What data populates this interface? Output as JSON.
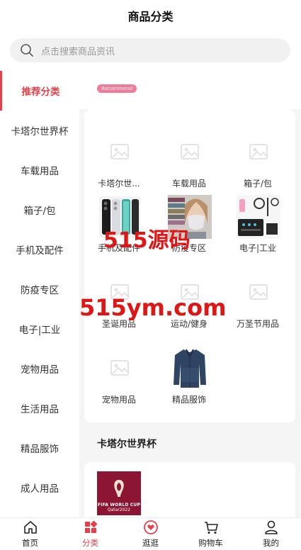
{
  "header": {
    "title": "商品分类"
  },
  "search": {
    "placeholder": "点击搜索商品资讯"
  },
  "sidebar": {
    "items": [
      {
        "label": "推荐分类",
        "active": true
      },
      {
        "label": "卡塔尔世界杯"
      },
      {
        "label": "车载用品"
      },
      {
        "label": "箱子/包"
      },
      {
        "label": "手机及配件"
      },
      {
        "label": "防疫专区"
      },
      {
        "label": "电子|工业"
      },
      {
        "label": "宠物用品"
      },
      {
        "label": "生活用品"
      },
      {
        "label": "精品服饰"
      },
      {
        "label": "成人用品"
      }
    ]
  },
  "recommend": {
    "badge": "Recommend"
  },
  "grid": {
    "items": [
      {
        "label": "卡塔尔世...",
        "icon": "image-placeholder-icon"
      },
      {
        "label": "车载用品",
        "icon": "image-placeholder-icon"
      },
      {
        "label": "箱子/包",
        "icon": "image-placeholder-icon"
      },
      {
        "label": "手机及配件",
        "icon": "phones-photo"
      },
      {
        "label": "防疫专区",
        "icon": "mask-photo"
      },
      {
        "label": "电子|工业",
        "icon": "electronics-photo"
      },
      {
        "label": "圣诞用品",
        "icon": "image-placeholder-icon"
      },
      {
        "label": "运动/健身",
        "icon": "image-placeholder-icon"
      },
      {
        "label": "万圣节用品",
        "icon": "image-placeholder-icon"
      },
      {
        "label": "宠物用品",
        "icon": "image-placeholder-icon"
      },
      {
        "label": "精品服饰",
        "icon": "shirt-photo"
      }
    ]
  },
  "section": {
    "title": "卡塔尔世界杯",
    "fifa_line1": "FIFA WORLD CUP",
    "fifa_line2": "Qatar2022"
  },
  "watermark": {
    "line1": "515源码",
    "line2": "515ym.com"
  },
  "tabbar": {
    "items": [
      {
        "label": "首页",
        "icon": "home-icon"
      },
      {
        "label": "分类",
        "icon": "category-icon",
        "active": true
      },
      {
        "label": "逛逛",
        "icon": "heart-bubble-icon"
      },
      {
        "label": "购物车",
        "icon": "cart-icon"
      },
      {
        "label": "我的",
        "icon": "user-icon"
      }
    ]
  },
  "colors": {
    "accent": "#e8404a",
    "badge": "#f27b9a",
    "fifa": "#8c1534"
  }
}
